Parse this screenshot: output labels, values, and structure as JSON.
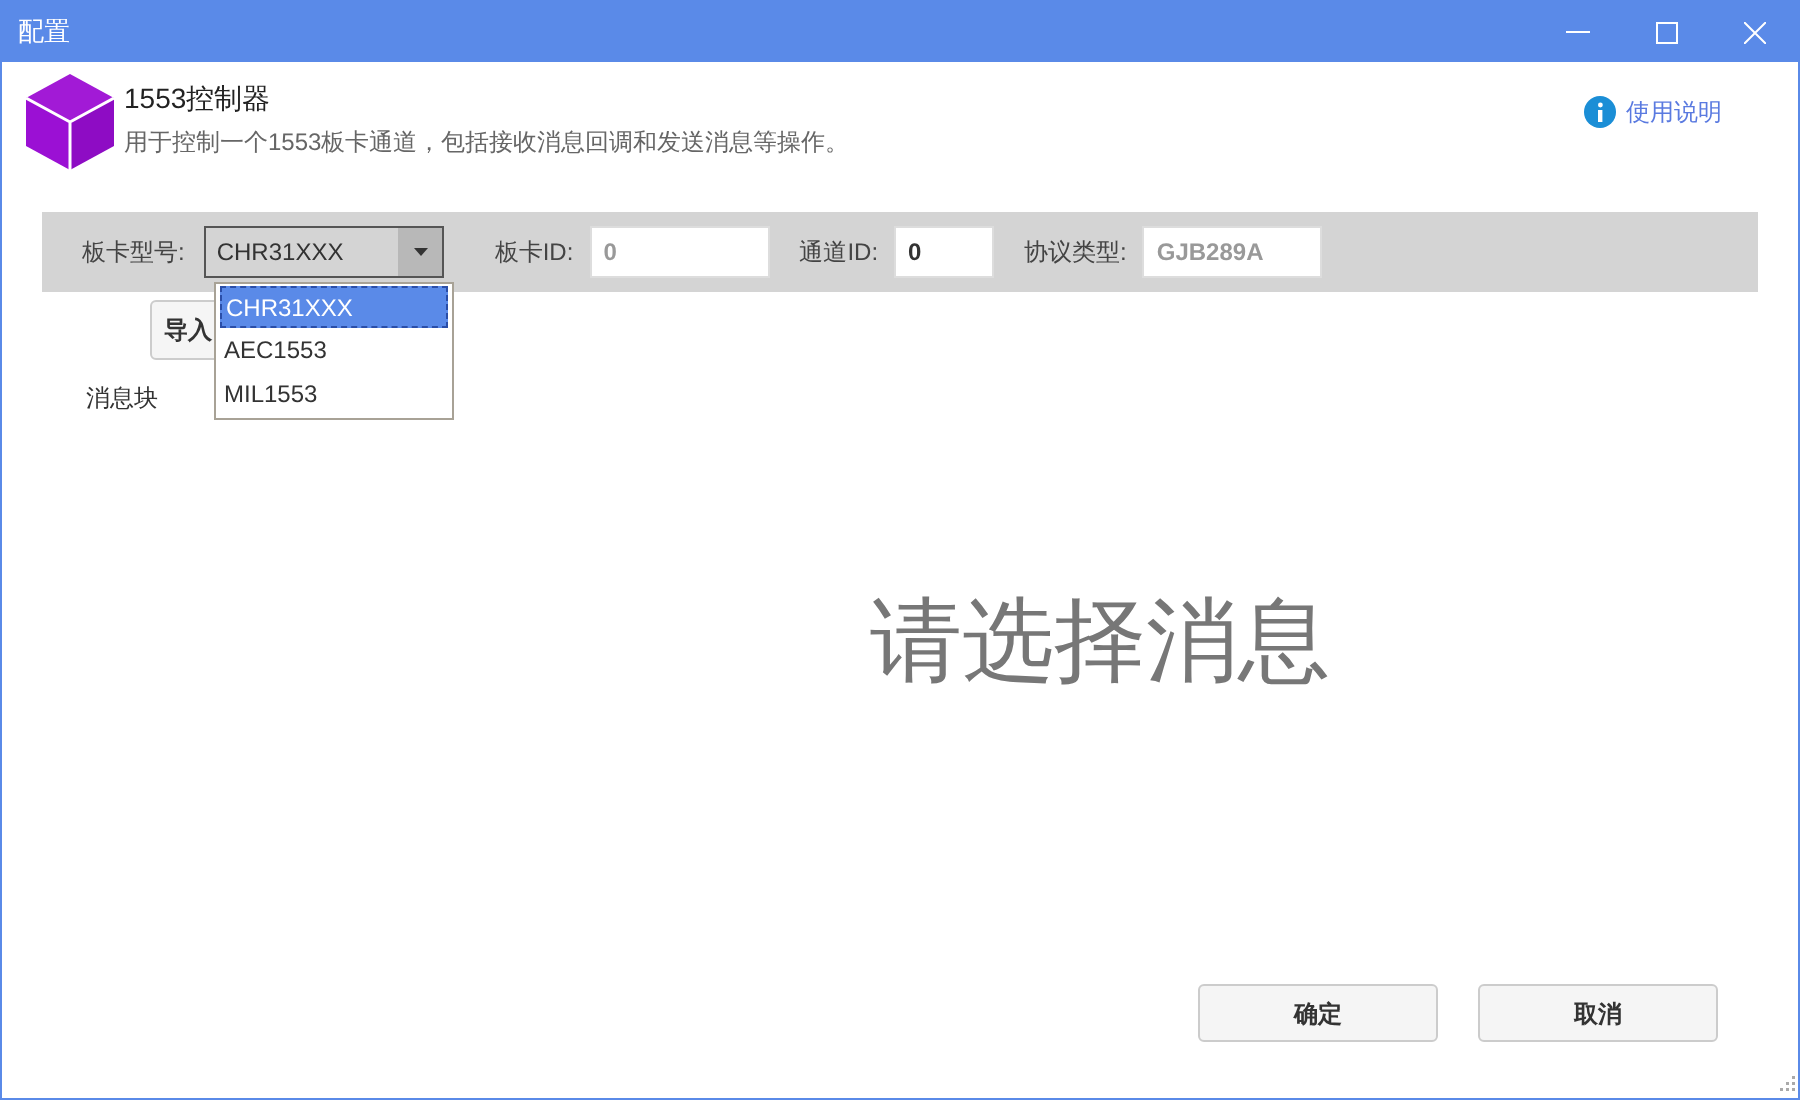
{
  "window": {
    "title": "配置"
  },
  "header": {
    "title": "1553控制器",
    "description": "用于控制一个1553板卡通道，包括接收消息回调和发送消息等操作。",
    "help_link": "使用说明"
  },
  "toolbar": {
    "board_type": {
      "label": "板卡型号:",
      "value": "CHR31XXX",
      "expanded": true,
      "options": [
        {
          "label": "CHR31XXX",
          "selected": true
        },
        {
          "label": "AEC1553",
          "selected": false
        },
        {
          "label": "MIL1553",
          "selected": false
        }
      ]
    },
    "board_id": {
      "label": "板卡ID:",
      "value": "0",
      "disabled": true
    },
    "channel_id": {
      "label": "通道ID:",
      "value": "0",
      "disabled": false
    },
    "protocol": {
      "label": "协议类型:",
      "value": "GJB289A",
      "disabled": true
    }
  },
  "import_button": "导入",
  "message_block_label": "消息块",
  "placeholder_message": "请选择消息",
  "buttons": [
    "确定",
    "取消"
  ]
}
